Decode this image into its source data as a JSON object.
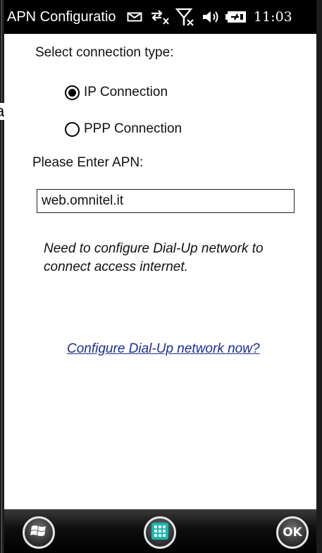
{
  "statusbar": {
    "title": "APN Configuratio",
    "time": "11:03",
    "icons": [
      "message-icon",
      "data-transfer-off-icon",
      "signal-off-icon",
      "volume-icon",
      "battery-charging-icon"
    ]
  },
  "stray_char": "a",
  "connection": {
    "label": "Select connection type:",
    "options": [
      {
        "label": "IP Connection",
        "selected": true
      },
      {
        "label": "PPP Connection",
        "selected": false
      }
    ]
  },
  "apn": {
    "label": "Please Enter APN:",
    "value": "web.omnitel.it"
  },
  "note": "Need to configure Dial-Up network to connect access internet.",
  "link": "Configure Dial-Up network now?",
  "softkeys": {
    "start_icon": "windows-start-icon",
    "apps_icon": "app-grid-icon",
    "ok_label": "OK"
  },
  "colors": {
    "statusbar_bg": "#000000",
    "link": "#1a2e9a",
    "content_bg": "#ffffff"
  }
}
